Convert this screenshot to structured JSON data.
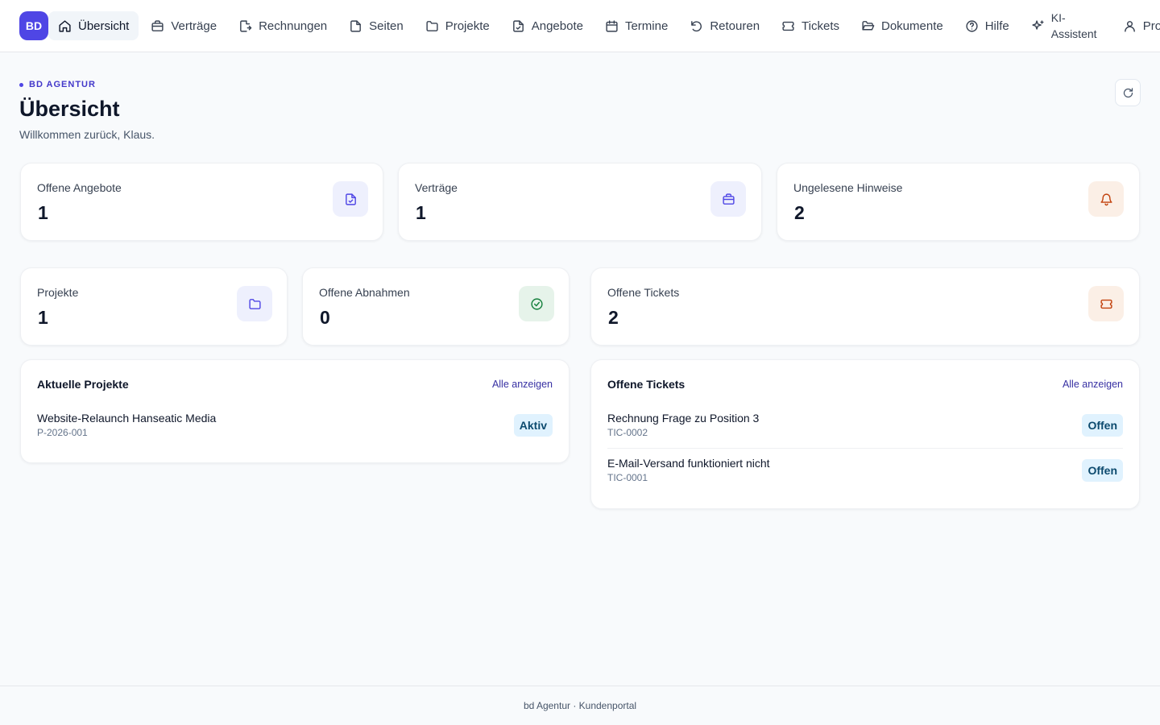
{
  "app": {
    "logo_text": "BD"
  },
  "nav": {
    "items": [
      {
        "label": "Übersicht",
        "icon": "home-icon"
      },
      {
        "label": "Verträge",
        "icon": "briefcase-icon"
      },
      {
        "label": "Rechnungen",
        "icon": "file-export-icon"
      },
      {
        "label": "Seiten",
        "icon": "file-icon"
      },
      {
        "label": "Projekte",
        "icon": "folder-icon"
      },
      {
        "label": "Angebote",
        "icon": "file-check-icon"
      },
      {
        "label": "Termine",
        "icon": "calendar-icon"
      },
      {
        "label": "Retouren",
        "icon": "rotate-ccw-icon"
      },
      {
        "label": "Tickets",
        "icon": "ticket-icon"
      },
      {
        "label": "Dokumente",
        "icon": "folder-open-icon"
      },
      {
        "label": "Hilfe",
        "icon": "help-circle-icon"
      },
      {
        "label": "KI-Assistent",
        "icon": "sparkles-icon"
      },
      {
        "label": "Profil",
        "icon": "user-icon"
      }
    ]
  },
  "header": {
    "eyebrow": "BD AGENTUR",
    "title": "Übersicht",
    "subtitle": "Willkommen zurück, Klaus."
  },
  "stats": [
    {
      "label": "Offene Angebote",
      "value": "1",
      "icon": "file-check-icon",
      "color": "#4f46e5"
    },
    {
      "label": "Verträge",
      "value": "1",
      "icon": "briefcase-icon",
      "color": "#4f46e5"
    },
    {
      "label": "Ungelesene Hinweise",
      "value": "2",
      "icon": "bell-icon",
      "color": "#c2410c"
    },
    {
      "label": "Projekte",
      "value": "1",
      "icon": "folder-icon",
      "color": "#4f46e5"
    },
    {
      "label": "Offene Abnahmen",
      "value": "0",
      "icon": "check-circle-icon",
      "color": "#15803d"
    },
    {
      "label": "Offene Tickets",
      "value": "2",
      "icon": "ticket-icon",
      "color": "#c2410c"
    }
  ],
  "projects_panel": {
    "title": "Aktuelle Projekte",
    "link": "Alle anzeigen",
    "items": [
      {
        "title": "Website-Relaunch Hanseatic Media",
        "code": "P-2026-001",
        "status": "Aktiv"
      }
    ]
  },
  "tickets_panel": {
    "title": "Offene Tickets",
    "link": "Alle anzeigen",
    "items": [
      {
        "title": "Rechnung Frage zu Position 3",
        "code": "TIC-0002",
        "status": "Offen"
      },
      {
        "title": "E-Mail-Versand funktioniert nicht",
        "code": "TIC-0001",
        "status": "Offen"
      }
    ]
  },
  "footer": {
    "text": "bd Agentur · Kundenportal"
  }
}
